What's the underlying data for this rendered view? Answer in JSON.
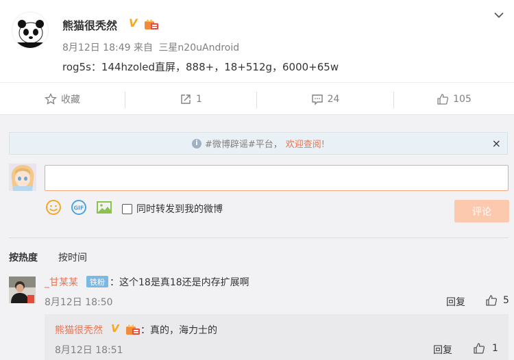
{
  "post": {
    "author": "熊猫很秃然",
    "verified_mark": "V",
    "time": "8月12日 18:49",
    "from_label": "来自",
    "source": "三星n20uAndroid",
    "content": "rog5s：144hzoled直屏，888+，18+512g，6000+65w"
  },
  "actions": {
    "favorite": "收藏",
    "repost": "1",
    "comment": "24",
    "like": "105"
  },
  "notice": {
    "info_glyph": "i",
    "text_gray": "#微博辟谣#平台，",
    "text_orange": "欢迎查阅!",
    "close": "×"
  },
  "composer": {
    "repost_checkbox_label": "同时转发到我的微博",
    "submit_label": "评论",
    "gif_label": "GIF"
  },
  "sort": {
    "hot": "按热度",
    "time": "按时间"
  },
  "comment": {
    "author": "_甘某某",
    "badge": "铁粉",
    "text": "：这个18是真18还是内存扩展啊",
    "time": "8月12日 18:50",
    "reply_label": "回复",
    "likes": "5"
  },
  "sub_reply": {
    "author": "熊猫很秃然",
    "verified_mark": "V",
    "text": "：真的，海力士的",
    "time": "8月12日 18:51",
    "reply_label": "回复",
    "likes": "1"
  },
  "colors": {
    "accent_orange": "#eb7350",
    "verified_gold": "#f5a623",
    "fan_badge_blue": "#7ab9e6",
    "submit_disabled": "#fdc9ae"
  }
}
